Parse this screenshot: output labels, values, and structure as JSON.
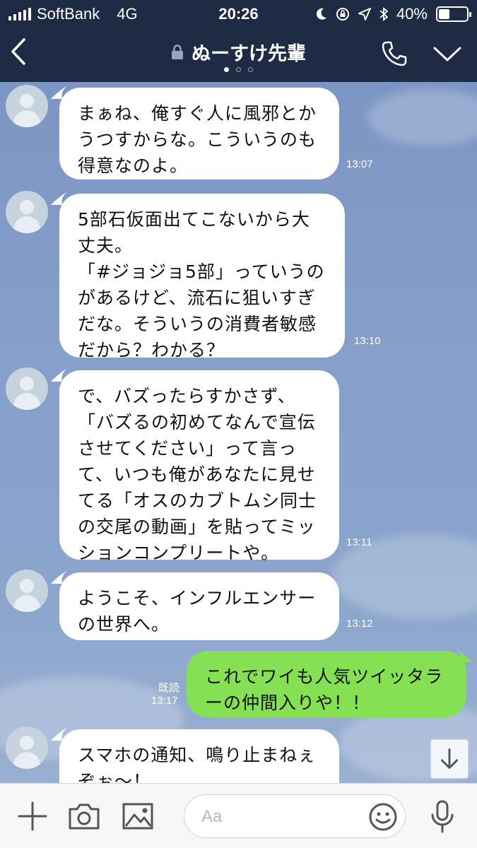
{
  "status_bar": {
    "carrier": "SoftBank",
    "network": "4G",
    "time": "20:26",
    "battery": "40%",
    "battery_level": 0.4
  },
  "header": {
    "title": "ぬーすけ先輩",
    "page_dots": 3,
    "active_dot": 0
  },
  "messages": [
    {
      "direction": "in",
      "text": "まぁね、俺すぐ人に風邪とか\nうつすからな。こういうのも\n得意なのよ。",
      "time": "13:07"
    },
    {
      "direction": "in",
      "text": "5部石仮面出てこないから大\n丈夫。\n「#ジョジョ5部」っていうの\nがあるけど、流石に狙いすぎ\nだな。そういうの消費者敏感\nだから？わかる？",
      "time": "13:10"
    },
    {
      "direction": "in",
      "text": "で、バズったらすかさず、\n「バズるの初めてなんで宣伝\nさせてください」って言っ\nて、いつも俺があなたに見せ\nてる「オスのカブトムシ同士\nの交尾の動画」を貼ってミッ\nションコンプリートや。",
      "time": "13:11"
    },
    {
      "direction": "in",
      "text": "ようこそ、インフルエンサー\nの世界へ。",
      "time": "13:12"
    },
    {
      "direction": "out",
      "text": "これでワイも人気ツイッタラ\nーの仲間入りや！！",
      "time": "13:17",
      "read": "既読"
    },
    {
      "direction": "in",
      "text": "スマホの通知、鳴り止まねぇ\nぞぉ～！",
      "time": ""
    }
  ],
  "input": {
    "placeholder": "Aa"
  },
  "colors": {
    "header_bg": "#1f2a44",
    "incoming_bubble": "#ffffff",
    "outgoing_bubble": "#85e153",
    "chat_bg": "#7f98c6"
  },
  "icons": [
    "back-arrow-icon",
    "lock-icon",
    "phone-icon",
    "chevron-down-icon",
    "plus-icon",
    "camera-icon",
    "image-icon",
    "emoji-icon",
    "microphone-icon",
    "arrow-down-icon"
  ]
}
